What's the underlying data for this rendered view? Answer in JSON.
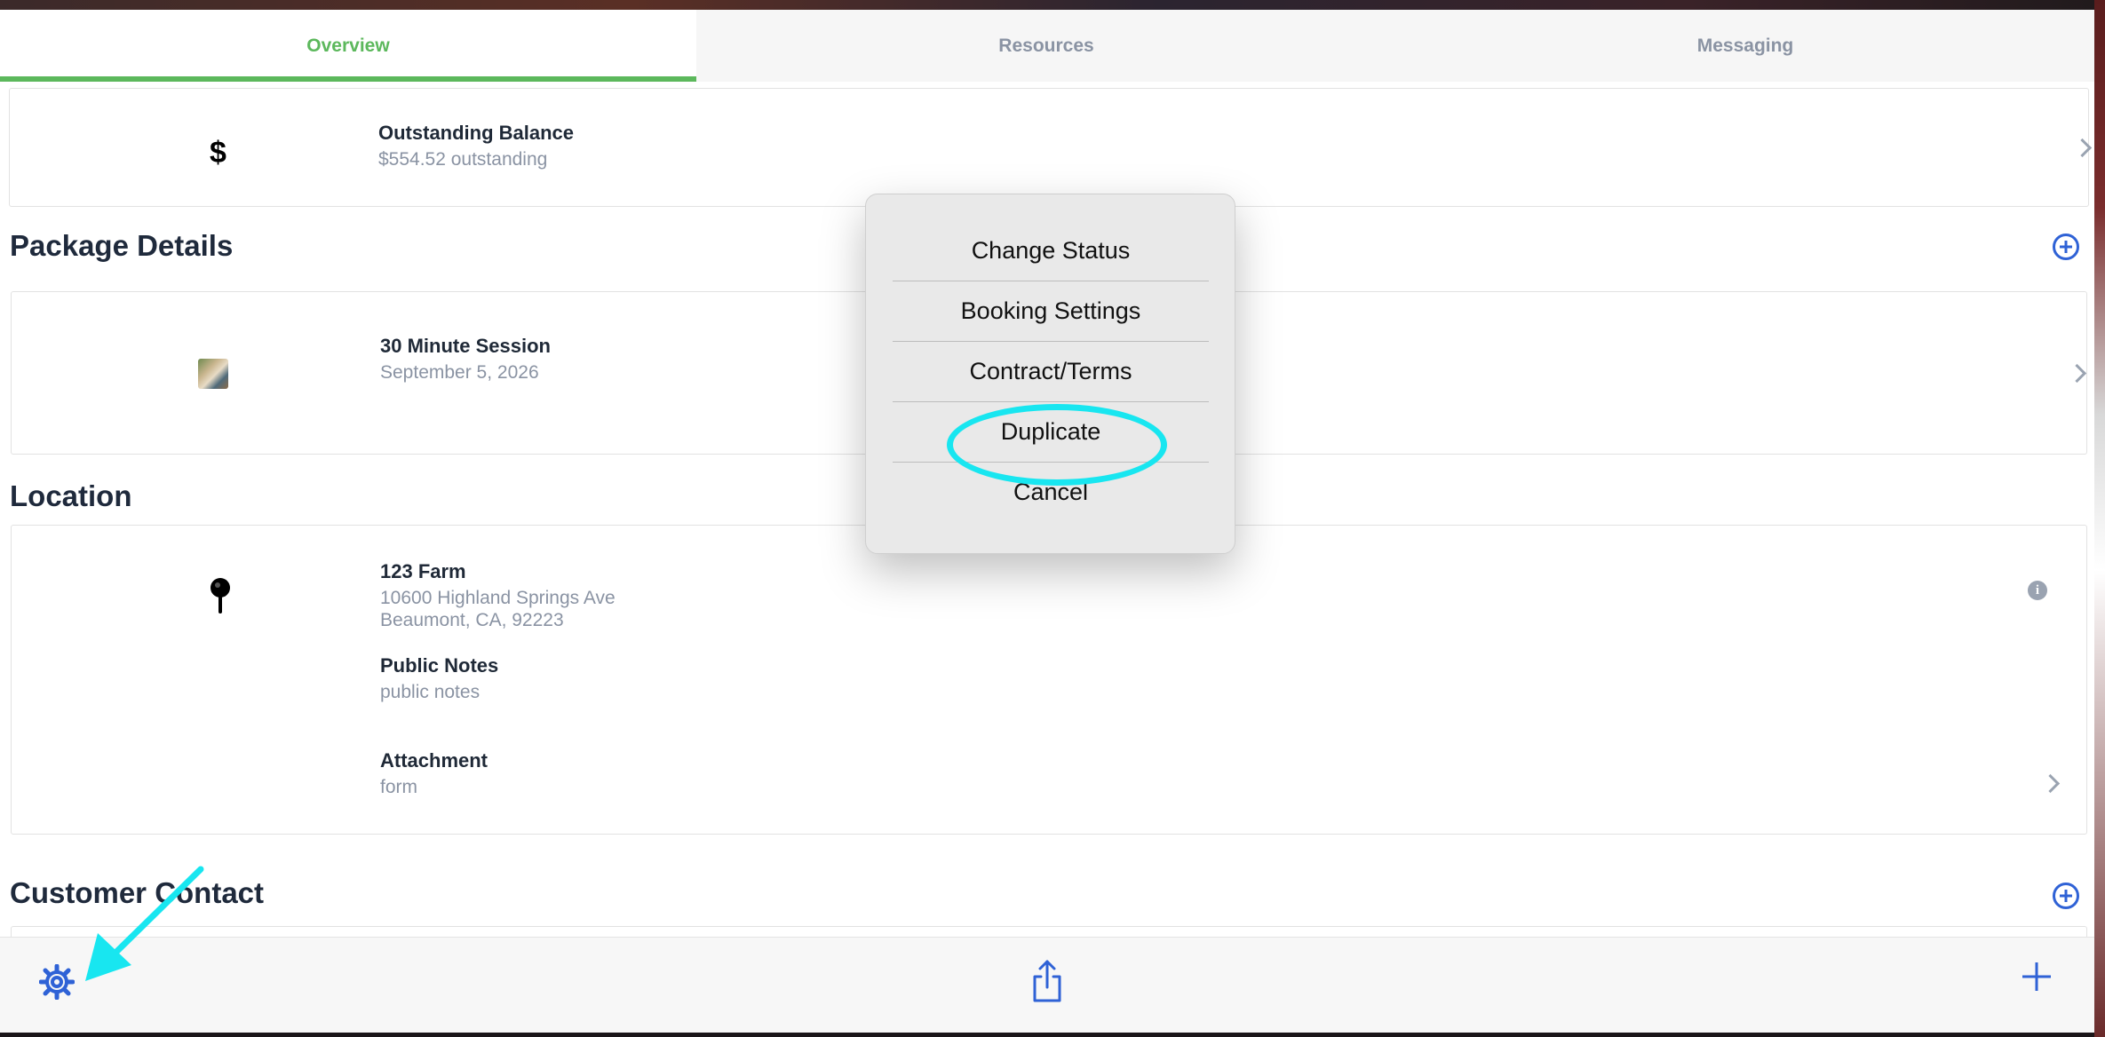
{
  "tabs": [
    {
      "label": "Overview",
      "active": true
    },
    {
      "label": "Resources",
      "active": false
    },
    {
      "label": "Messaging",
      "active": false
    }
  ],
  "balance": {
    "icon": "dollar-icon",
    "symbol": "$",
    "title": "Outstanding Balance",
    "subtitle": "$554.52 outstanding"
  },
  "package_details": {
    "heading": "Package Details",
    "item": {
      "title": "30 Minute Session",
      "date": "September 5, 2026"
    }
  },
  "location": {
    "heading": "Location",
    "name": "123 Farm",
    "address_line1": "10600 Highland Springs Ave",
    "address_line2": "Beaumont, CA, 92223",
    "public_notes_label": "Public Notes",
    "public_notes": "public notes",
    "attachment_label": "Attachment",
    "attachment": "form",
    "info_glyph": "i"
  },
  "customer_contact": {
    "heading": "Customer Contact"
  },
  "menu": {
    "items": [
      "Change Status",
      "Booking Settings",
      "Contract/Terms",
      "Duplicate",
      "Cancel"
    ]
  },
  "colors": {
    "accent_green": "#5cb85c",
    "accent_blue": "#2f62d6",
    "annotation_cyan": "#18e6f0"
  }
}
